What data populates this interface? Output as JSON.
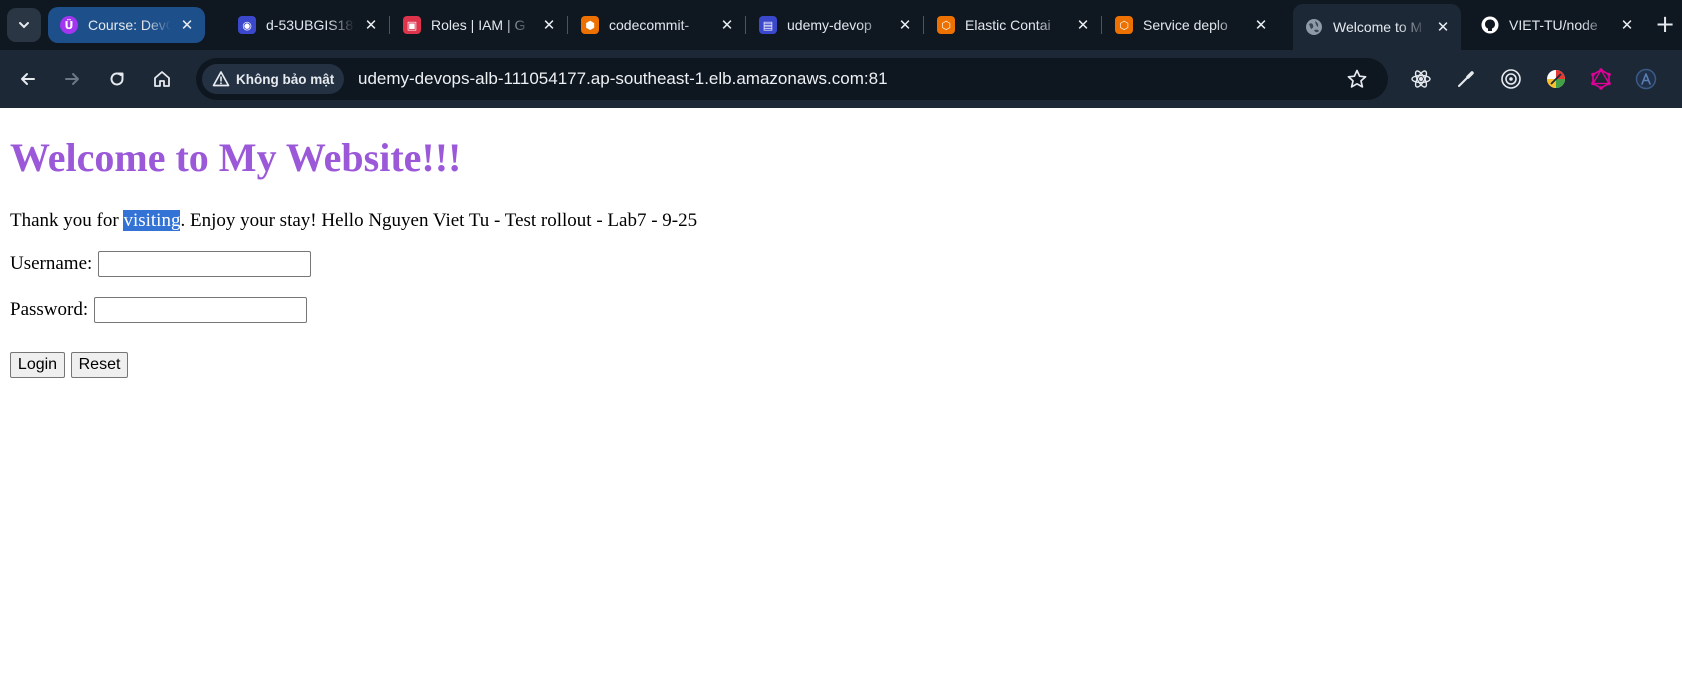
{
  "browser": {
    "tabs": [
      {
        "title": "Course: DevO",
        "icon": "udemy-icon",
        "icon_glyph": "Ü",
        "icon_color": "#a435f0"
      },
      {
        "title": "d-53UBGIS18",
        "icon": "codedeploy-icon",
        "icon_glyph": "◉",
        "icon_color": "#3b48cc"
      },
      {
        "title": "Roles | IAM | G",
        "icon": "iam-icon",
        "icon_glyph": "▣",
        "icon_color": "#dd344c"
      },
      {
        "title": "codecommit-",
        "icon": "codecommit-icon",
        "icon_glyph": "⬢",
        "icon_color": "#ed7100"
      },
      {
        "title": "udemy-devop",
        "icon": "codepipeline-icon",
        "icon_glyph": "▤",
        "icon_color": "#3b48cc"
      },
      {
        "title": "Elastic Contai",
        "icon": "ecs-icon",
        "icon_glyph": "⬡",
        "icon_color": "#ed7100"
      },
      {
        "title": "Service deplo",
        "icon": "ecs-icon",
        "icon_glyph": "⬡",
        "icon_color": "#ed7100"
      },
      {
        "title": "Welcome to M",
        "icon": "globe-icon",
        "icon_glyph": "",
        "icon_color": "#8e9aa8",
        "active": true
      },
      {
        "title": "VIET-TU/node",
        "icon": "github-icon",
        "icon_glyph": "",
        "icon_color": "#ffffff"
      }
    ],
    "new_tab_label": "+",
    "security_label": "Không bảo mật",
    "url": "udemy-devops-alb-111054177.ap-southeast-1.elb.amazonaws.com:81"
  },
  "page": {
    "heading": "Welcome to My Website!!!",
    "intro_before": "Thank you for ",
    "intro_selected": "visiting",
    "intro_after": ". Enjoy your stay! Hello Nguyen Viet Tu - Test rollout - Lab7 - 9-25",
    "username_label": "Username:",
    "username_value": "",
    "password_label": "Password:",
    "password_value": "",
    "login_label": "Login",
    "reset_label": "Reset"
  },
  "colors": {
    "heading": "#9b59d9",
    "selection": "#3373d6",
    "tabstrip": "#0f1720",
    "toolbar": "#1c2836"
  }
}
